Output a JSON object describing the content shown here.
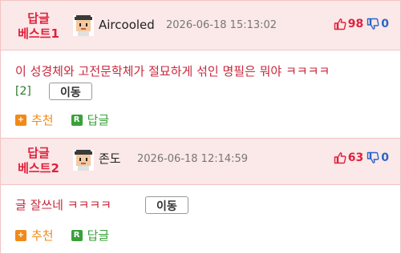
{
  "comments": [
    {
      "badge_line1": "답글",
      "badge_line2": "베스트1",
      "nickname": "Aircooled",
      "date": "2026-06-18 15:13:02",
      "up_count": "98",
      "down_count": "0",
      "text": "이 성경체와 고전문학체가 절묘하게 섞인 명필은 뭐야 ㅋㅋㅋㅋ",
      "reply_count": "[2]",
      "move_label": "이동",
      "recommend_label": "추천",
      "reply_label": "답글"
    },
    {
      "badge_line1": "답글",
      "badge_line2": "베스트2",
      "nickname": "존도",
      "date": "2026-06-18 12:14:59",
      "up_count": "63",
      "down_count": "0",
      "text": "글 잘쓰네 ㅋㅋㅋㅋ",
      "move_label": "이동",
      "recommend_label": "추천",
      "reply_label": "답글"
    }
  ],
  "icons": {
    "avatar": "pixel-avatar-icon",
    "thumb_up": "thumbs-up-icon",
    "thumb_down": "thumbs-down-icon",
    "recommend": "plus-square-icon",
    "reply": "r-square-icon"
  },
  "colors": {
    "badge": "#e0203c",
    "header_bg": "#fbe8e8",
    "comment_text": "#c8283c",
    "up_vote": "#e0203c",
    "down_vote": "#2a64c8",
    "recommend": "#f08a18",
    "reply": "#3aa03a"
  }
}
